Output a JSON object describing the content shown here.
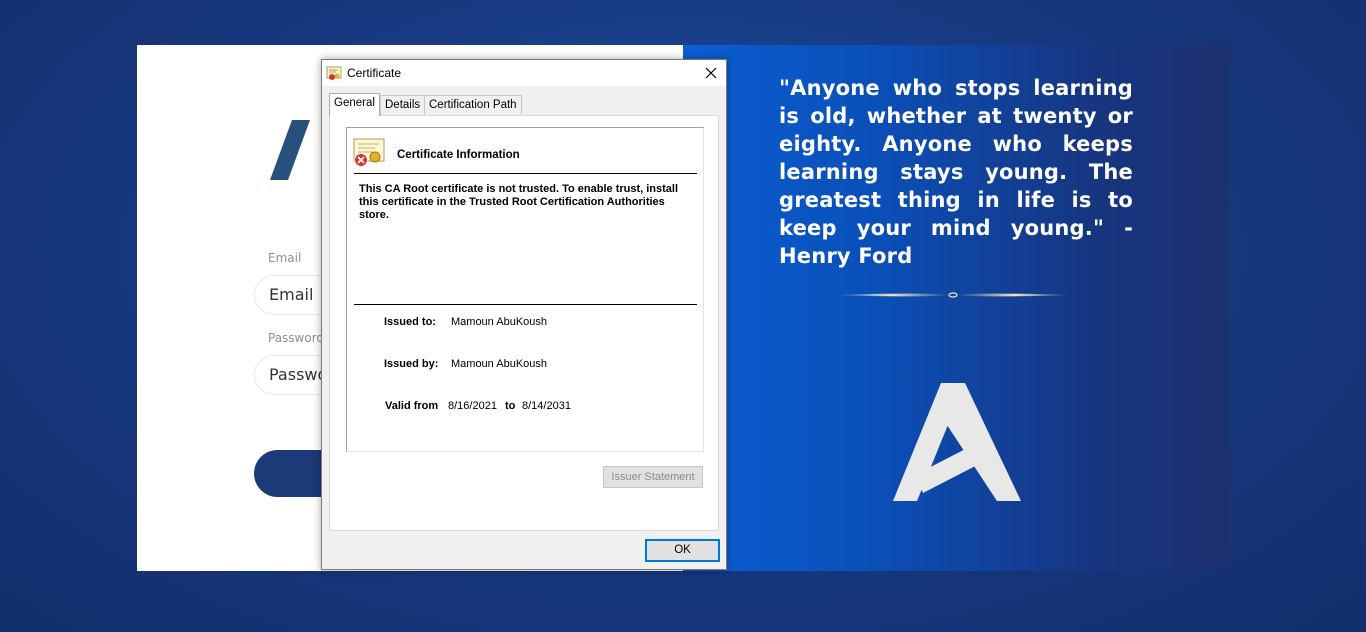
{
  "login": {
    "email_label": "Email",
    "email_placeholder": "Email",
    "password_label": "Password",
    "password_placeholder": "Password"
  },
  "quote": {
    "text": "\"Anyone who stops learning is old, whether at twenty or eighty. Anyone who keeps learning stays young. The greatest thing in life is to keep your mind young.\" -Henry Ford"
  },
  "dialog": {
    "title": "Certificate",
    "tabs": [
      "General",
      "Details",
      "Certification Path"
    ],
    "info_title": "Certificate Information",
    "message": "This CA Root certificate is not trusted. To enable trust, install this certificate in the Trusted Root Certification Authorities store.",
    "issued_to_label": "Issued to:",
    "issued_to": "Mamoun AbuKoush",
    "issued_by_label": "Issued by:",
    "issued_by": "Mamoun AbuKoush",
    "valid_from_label": "Valid from",
    "valid_from": "8/16/2021",
    "to_label": "to",
    "valid_to": "8/14/2031",
    "issuer_statement_button": "Issuer Statement",
    "ok_button": "OK"
  },
  "icons": {
    "title": "certificate-icon",
    "close": "close-icon",
    "info": "certificate-error-icon",
    "logo": "brand-logo"
  },
  "colors": {
    "background": "#17387e",
    "panel_gradient_start": "#0b5fd4",
    "panel_gradient_end": "#1c2f6e",
    "button": "#1d3a78",
    "ok_focus": "#0078d7"
  }
}
